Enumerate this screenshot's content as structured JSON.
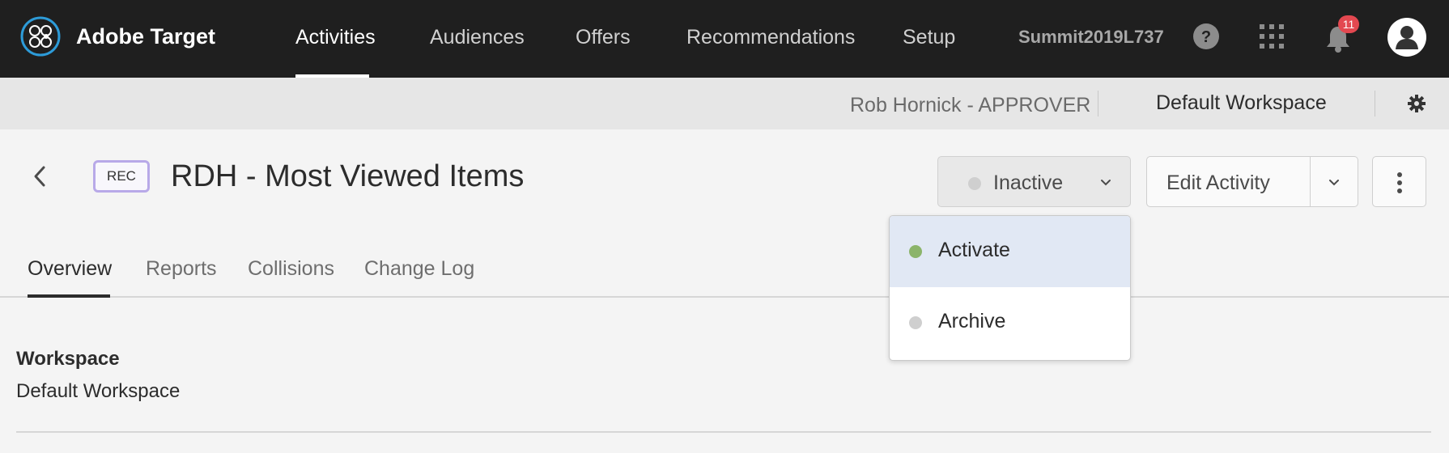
{
  "app": {
    "brand": "Adobe Target",
    "nav": [
      {
        "label": "Activities",
        "active": true
      },
      {
        "label": "Audiences"
      },
      {
        "label": "Offers"
      },
      {
        "label": "Recommendations"
      },
      {
        "label": "Setup"
      }
    ],
    "tenant": "Summit2019L737",
    "notification_count": "11",
    "icons": [
      "adobe-target-logo-icon",
      "help-icon",
      "apps-grid-icon",
      "bell-icon",
      "user-avatar-icon"
    ]
  },
  "subbar": {
    "user_role": "Rob Hornick - APPROVER",
    "workspace": "Default Workspace",
    "settings_icon": "gear-icon"
  },
  "activity": {
    "type_tag": "REC",
    "title": "RDH - Most Viewed Items",
    "status": "Inactive",
    "edit_label": "Edit Activity",
    "colors": {
      "inactive": "#cfcfcf",
      "activate": "#8bb46a",
      "highlight": "#e1e8f4",
      "tag_border": "#b8a9e8"
    }
  },
  "status_menu": [
    {
      "label": "Activate",
      "highlighted": true,
      "dot_color": "#8bb46a"
    },
    {
      "label": "Archive",
      "highlighted": false,
      "dot_color": "#cfcfcf"
    }
  ],
  "tabs": [
    {
      "label": "Overview",
      "active": true
    },
    {
      "label": "Reports"
    },
    {
      "label": "Collisions"
    },
    {
      "label": "Change Log"
    }
  ],
  "details": {
    "workspace_label": "Workspace",
    "workspace_value": "Default Workspace"
  }
}
